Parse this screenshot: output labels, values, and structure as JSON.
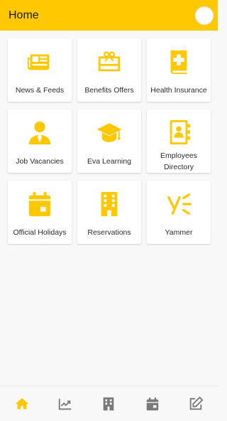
{
  "header": {
    "title": "Home",
    "avatar_icon": "user-avatar-icon"
  },
  "colors": {
    "accent": "#FFC800",
    "icon_gray": "#7a7a7a",
    "background": "#f8f8f8"
  },
  "tiles": [
    {
      "label": "News & Feeds",
      "icon": "newspaper-icon"
    },
    {
      "label": "Benefits Offers",
      "icon": "gift-card-icon"
    },
    {
      "label": "Health Insurance",
      "icon": "medical-book-icon"
    },
    {
      "label": "Job Vacancies",
      "icon": "person-icon"
    },
    {
      "label": "Eva Learning",
      "icon": "graduation-cap-icon"
    },
    {
      "label": "Employees Directory",
      "icon": "contacts-book-icon"
    },
    {
      "label": "Official Holidays",
      "icon": "calendar-icon"
    },
    {
      "label": "Reservations",
      "icon": "building-icon"
    },
    {
      "label": "Yammer",
      "icon": "yammer-icon"
    }
  ],
  "bottom_nav": [
    {
      "icon": "home-icon",
      "active": true
    },
    {
      "icon": "chart-trend-icon",
      "active": false
    },
    {
      "icon": "building-icon",
      "active": false
    },
    {
      "icon": "calendar-icon",
      "active": false
    },
    {
      "icon": "edit-icon",
      "active": false
    }
  ]
}
